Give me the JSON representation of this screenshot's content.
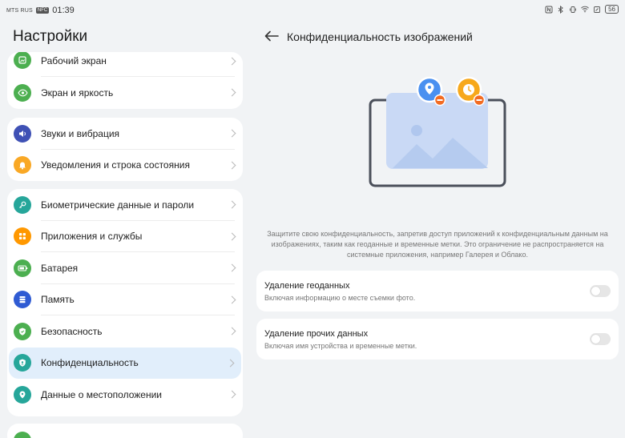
{
  "status_bar": {
    "carrier": "MTS RUS",
    "carrier_badge": "NFC",
    "time": "01:39",
    "battery": "56"
  },
  "left": {
    "title": "Настройки",
    "groups": [
      {
        "items": [
          {
            "label": "Рабочий экран",
            "icon": "home-screen-icon",
            "color": "#4caf50"
          },
          {
            "label": "Экран и яркость",
            "icon": "eye-icon",
            "color": "#4caf50"
          }
        ]
      },
      {
        "items": [
          {
            "label": "Звуки и вибрация",
            "icon": "speaker-icon",
            "color": "#3f51b5"
          },
          {
            "label": "Уведомления и строка состояния",
            "icon": "bell-icon",
            "color": "#f9a825"
          }
        ]
      },
      {
        "items": [
          {
            "label": "Биометрические данные и пароли",
            "icon": "key-icon",
            "color": "#26a69a"
          },
          {
            "label": "Приложения и службы",
            "icon": "apps-grid-icon",
            "color": "#ff9800"
          },
          {
            "label": "Батарея",
            "icon": "battery-icon",
            "color": "#4caf50"
          },
          {
            "label": "Память",
            "icon": "storage-icon",
            "color": "#2f5bd3"
          },
          {
            "label": "Безопасность",
            "icon": "shield-icon",
            "color": "#4caf50"
          },
          {
            "label": "Конфиденциальность",
            "icon": "privacy-shield-icon",
            "color": "#26a69a"
          },
          {
            "label": "Данные о местоположении",
            "icon": "location-pin-icon",
            "color": "#26a69a"
          }
        ]
      }
    ]
  },
  "right": {
    "title": "Конфиденциальность изображений",
    "description": "Защитите свою конфиденциальность, запретив доступ приложений к конфиденциальным данным на изображениях, таким как геоданные и временные метки. Это ограничение не распространяется на системные приложения, например Галерея и Облако.",
    "options": [
      {
        "title": "Удаление геоданных",
        "subtitle": "Включая информацию о месте съемки фото.",
        "enabled": false
      },
      {
        "title": "Удаление прочих данных",
        "subtitle": "Включая имя устройства и временные метки.",
        "enabled": false
      }
    ],
    "colors": {
      "accent": "#3b7ff0",
      "pin": "#4a90f0",
      "clock": "#f7a81b",
      "remove": "#f26b22"
    }
  }
}
